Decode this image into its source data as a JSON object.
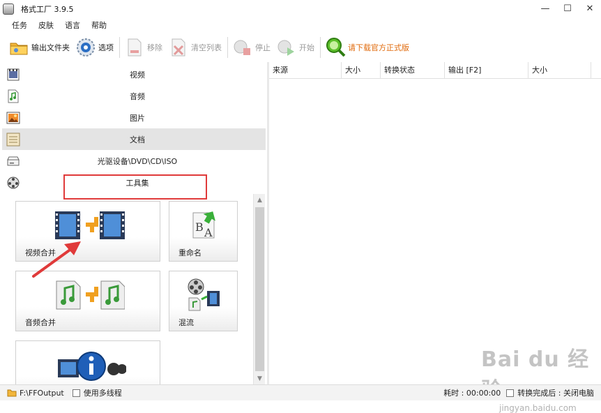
{
  "window": {
    "title": "格式工厂 3.9.5",
    "controls": [
      "—",
      "☐",
      "✕"
    ]
  },
  "menu": [
    "任务",
    "皮肤",
    "语言",
    "帮助"
  ],
  "toolbar": {
    "output_folder": "输出文件夹",
    "options": "选项",
    "remove": "移除",
    "clear_list": "清空列表",
    "stop": "停止",
    "start": "开始",
    "download_official": "请下载官方正式版"
  },
  "categories": [
    {
      "label": "视频",
      "icon": "video-icon"
    },
    {
      "label": "音频",
      "icon": "audio-icon"
    },
    {
      "label": "图片",
      "icon": "picture-icon"
    },
    {
      "label": "文档",
      "icon": "document-icon",
      "selected": true
    },
    {
      "label": "光驱设备\\DVD\\CD\\ISO",
      "icon": "disc-icon"
    },
    {
      "label": "工具集",
      "icon": "tools-icon"
    }
  ],
  "tools": [
    {
      "label": "视频合并",
      "icon": "video-merge-icon"
    },
    {
      "label": "重命名",
      "icon": "rename-icon"
    },
    {
      "label": "音频合并",
      "icon": "audio-merge-icon"
    },
    {
      "label": "混流",
      "icon": "mux-icon"
    },
    {
      "label": "",
      "icon": "media-info-icon"
    }
  ],
  "task_table": {
    "columns": [
      "来源",
      "大小",
      "转换状态",
      "输出 [F2]",
      "大小"
    ]
  },
  "status": {
    "output_path": "F:\\FFOutput",
    "multithread": "使用多线程",
    "elapsed_label": "耗时 : 00:00:00",
    "after_convert": "转换完成后 : 关闭电脑"
  },
  "watermark": {
    "brand": "Bai du 经验",
    "url": "jingyan.baidu.com"
  },
  "colors": {
    "accent": "#e0690a",
    "highlight_box": "#e03a3a",
    "selected_row": "#e4e4e4"
  }
}
